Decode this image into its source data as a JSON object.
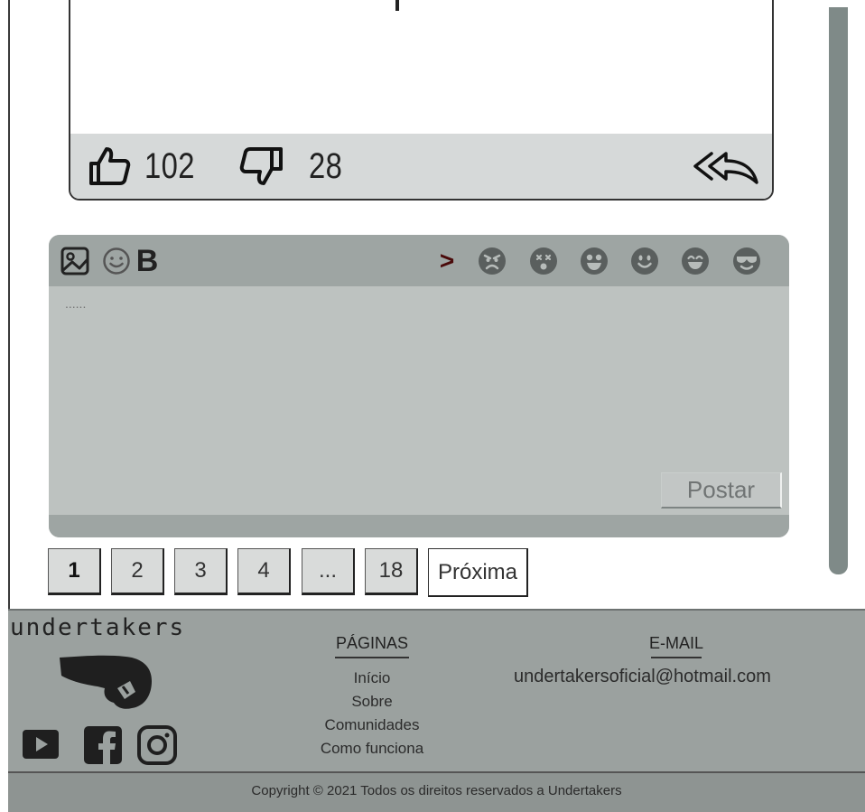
{
  "post": {
    "likes": "102",
    "dislikes": "28",
    "like_icon": "thumbs-up-icon",
    "dislike_icon": "thumbs-down-icon",
    "reply_icon": "reply-all-icon"
  },
  "editor": {
    "placeholder": "......",
    "toolbar": {
      "image_icon": "image-icon",
      "emoji_icon": "emoji-icon",
      "bold_label": "B",
      "expand_label": ">",
      "reactions": [
        "angry-face-icon",
        "dizzy-face-icon",
        "grin-face-icon",
        "smile-face-icon",
        "happy-face-icon",
        "cool-face-icon"
      ]
    },
    "submit_label": "Postar"
  },
  "pagination": {
    "pages": [
      "1",
      "2",
      "3",
      "4",
      "...",
      "18"
    ],
    "active": "1",
    "next_label": "Próxima"
  },
  "footer": {
    "brand": "undertakers",
    "pages_heading": "PÁGINAS",
    "pages_links": [
      "Início",
      "Sobre",
      "Comunidades",
      "Como funciona"
    ],
    "email_heading": "E-MAIL",
    "email": "undertakersoficial@hotmail.com",
    "social": [
      "youtube-icon",
      "facebook-icon",
      "instagram-icon"
    ],
    "copyright": "Copyright © 2021 Todos os direitos reservados a Undertakers"
  },
  "colors": {
    "editor_bg": "#bdc2c0",
    "editor_toolbar": "#9ea5a3",
    "footer_bg": "#9ba19f",
    "scrollbar": "#7f8a88",
    "expand_arrow": "#4a0a0a"
  }
}
